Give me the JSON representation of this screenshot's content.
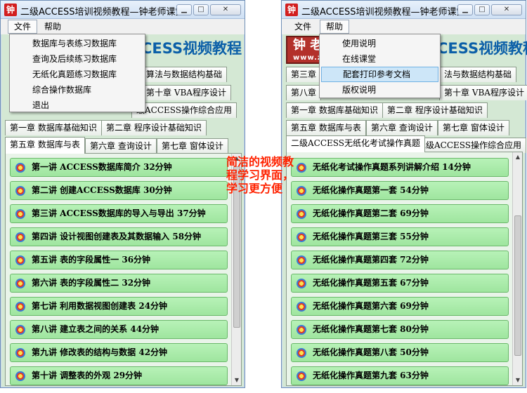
{
  "app_title": "二级ACCESS培训视频教程—钟老师课堂",
  "icon_char": "钟",
  "banner_text": "CESS视频教程",
  "logo_text": "钟 老",
  "logo_sub": "www.z",
  "caption": "简洁的视频教程学习界面，学习更方便",
  "left": {
    "menus": [
      "文件",
      "帮助"
    ],
    "file_menu": [
      "数据库与表练习数据库",
      "查询及后续练习数据库",
      "无纸化真题练习数据库",
      "综合操作数据库",
      "退出"
    ],
    "tab_rows": [
      [
        "算法与数据结构基础"
      ],
      [
        "第十章 VBA程序设计"
      ],
      [
        "级ACCESS操作综合应用"
      ],
      [
        "第一章 数据库基础知识",
        "第二章 程序设计基础知识"
      ],
      [
        "第五章 数据库与表",
        "第六章 查询设计",
        "第七章 窗体设计"
      ]
    ],
    "lessons": [
      "第一讲 ACCESS数据库简介 32分钟",
      "第二讲 创建ACCESS数据库 30分钟",
      "第三讲 ACCESS数据库的导入与导出 37分钟",
      "第四讲 设计视图创建表及其数据输入 58分钟",
      "第五讲 表的字段属性一 36分钟",
      "第六讲 表的字段属性二 32分钟",
      "第七讲 利用数据视图创建表 24分钟",
      "第八讲 建立表之间的关系 44分钟",
      "第九讲 修改表的结构与数据 42分钟",
      "第十讲 调整表的外观 29分钟"
    ]
  },
  "right": {
    "menus": [
      "文件",
      "帮助"
    ],
    "help_menu": [
      "使用说明",
      "在线课堂",
      "配套打印参考文档",
      "版权说明"
    ],
    "tab_rows": [
      [
        "第三章",
        "法与数据结构基础"
      ],
      [
        "第八章",
        "第十章 VBA程序设计"
      ],
      [
        "第一章 数据库基础知识",
        "第二章 程序设计基础知识"
      ],
      [
        "第五章 数据库与表",
        "第六章 查询设计",
        "第七章 窗体设计"
      ],
      [
        "二级ACCESS无纸化考试操作真题",
        "二级ACCESS操作综合应用"
      ]
    ],
    "lessons": [
      "无纸化考试操作真题系列讲解介绍  14分钟",
      "无纸化操作真题第一套  54分钟",
      "无纸化操作真题第二套  69分钟",
      "无纸化操作真题第三套  55分钟",
      "无纸化操作真题第四套  72分钟",
      "无纸化操作真题第五套  67分钟",
      "无纸化操作真题第六套  69分钟",
      "无纸化操作真题第七套  80分钟",
      "无纸化操作真题第八套  50分钟",
      "无纸化操作真题第九套  63分钟"
    ]
  },
  "colors": {
    "window_bg": "#d4e8d4",
    "lesson_bg": "#a8eca8",
    "caption": "#ff2200",
    "banner": "#0b5fa8",
    "highlight": "#cde6f8"
  }
}
